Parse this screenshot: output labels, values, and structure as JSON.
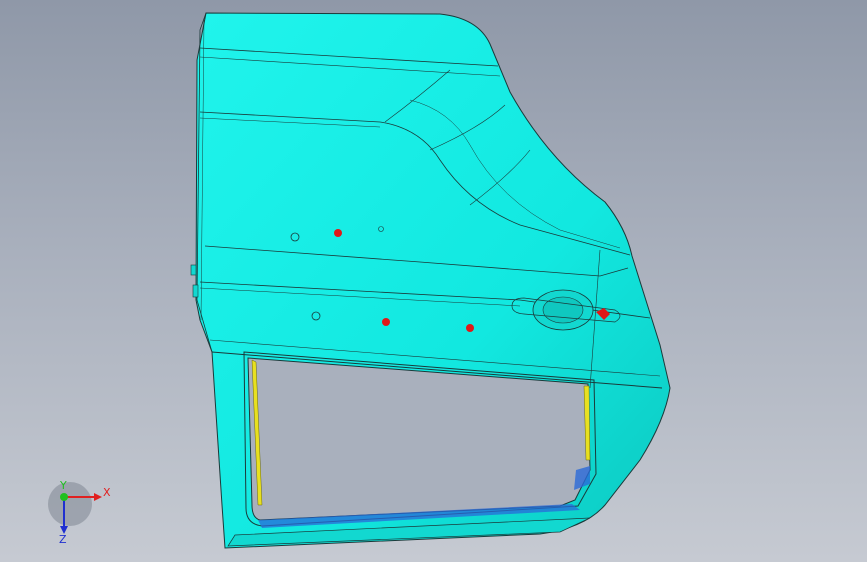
{
  "viewport": {
    "background_top": "#8f98a8",
    "background_bottom": "#c6cad2"
  },
  "model": {
    "part": "door-panel",
    "surface_color": "#19f0e8",
    "edge_color": "#1a3a3a",
    "hole_color": "#e01818",
    "seal_color": "#e8e020",
    "highlight_color": "#2a6ad8"
  },
  "triad": {
    "x_label": "X",
    "y_label": "Y",
    "z_label": "Z",
    "x_color": "#e02020",
    "y_color": "#20c020",
    "z_color": "#2030d0"
  }
}
